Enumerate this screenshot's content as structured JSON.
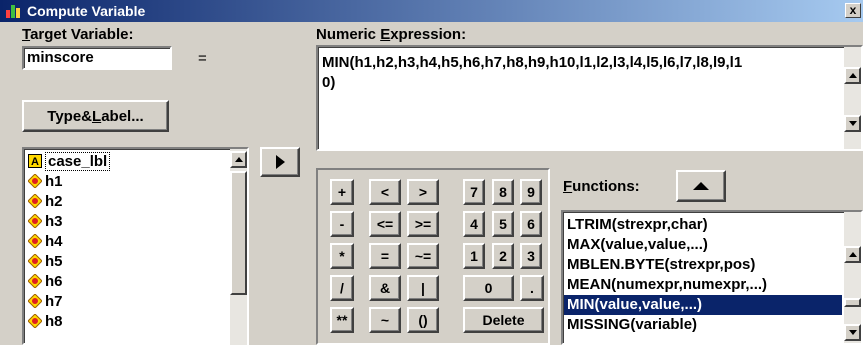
{
  "window": {
    "title": "Compute Variable",
    "close_label": "x"
  },
  "target": {
    "label_prefix": "T",
    "label_rest": "arget Variable:",
    "value": "minscore",
    "equals": "="
  },
  "type_label_button": {
    "pre": "Type&",
    "ul": "L",
    "post": "abel..."
  },
  "expression": {
    "label_pre": "Numeric ",
    "label_ul": "E",
    "label_post": "xpression:",
    "line1": "MIN(h1,h2,h3,h4,h5,h6,h7,h8,h9,h10,l1,l2,l3,l4,l5,l6,l7,l8,l9,l1",
    "line2": "0)"
  },
  "variables": [
    {
      "name": "case_lbl",
      "type": "string",
      "selected": true
    },
    {
      "name": "h1",
      "type": "numeric"
    },
    {
      "name": "h2",
      "type": "numeric"
    },
    {
      "name": "h3",
      "type": "numeric"
    },
    {
      "name": "h4",
      "type": "numeric"
    },
    {
      "name": "h5",
      "type": "numeric"
    },
    {
      "name": "h6",
      "type": "numeric"
    },
    {
      "name": "h7",
      "type": "numeric"
    },
    {
      "name": "h8",
      "type": "numeric"
    }
  ],
  "keypad": {
    "row1": [
      "+",
      "<",
      ">",
      "7",
      "8",
      "9"
    ],
    "row2": [
      "-",
      "<=",
      ">=",
      "4",
      "5",
      "6"
    ],
    "row3": [
      "*",
      "=",
      "~=",
      "1",
      "2",
      "3"
    ],
    "row4": [
      "/",
      "&",
      "|",
      "0",
      "."
    ],
    "row5": [
      "**",
      "~",
      "()",
      "Delete"
    ]
  },
  "functions": {
    "label_ul": "F",
    "label_rest": "unctions:",
    "items": [
      "LTRIM(strexpr,char)",
      "MAX(value,value,...)",
      "MBLEN.BYTE(strexpr,pos)",
      "MEAN(numexpr,numexpr,...)",
      "MIN(value,value,...)",
      "MISSING(variable)"
    ],
    "selected_index": 4
  },
  "colors": {
    "titlebar_start": "#0a246a",
    "titlebar_end": "#a6caf0",
    "selection": "#0a246a",
    "dialog_bg": "#d4d0c8"
  }
}
